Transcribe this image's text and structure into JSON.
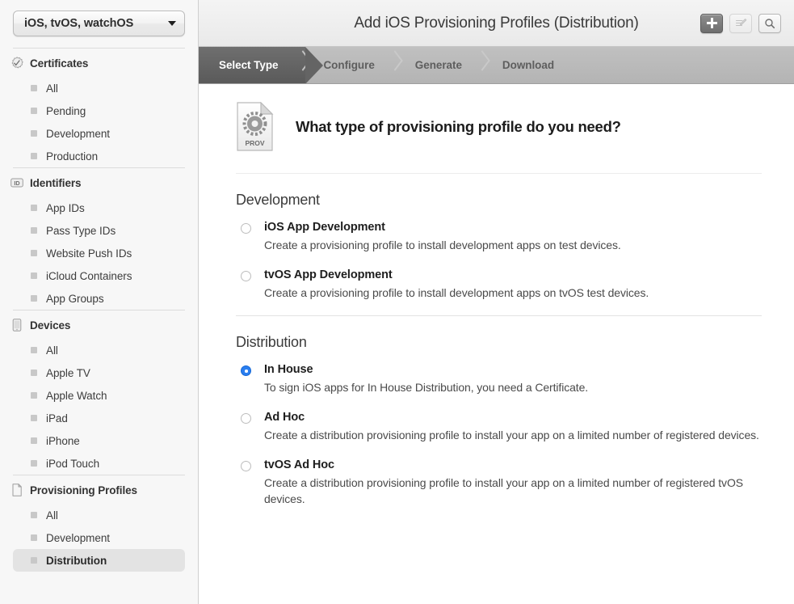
{
  "sidebar": {
    "team_select": {
      "value": "iOS, tvOS, watchOS",
      "icon": "chevron-down-icon"
    },
    "groups": [
      {
        "header": "Certificates",
        "icon": "certificate-seal-icon",
        "items": [
          {
            "label": "All",
            "selected": false
          },
          {
            "label": "Pending",
            "selected": false
          },
          {
            "label": "Development",
            "selected": false
          },
          {
            "label": "Production",
            "selected": false
          }
        ]
      },
      {
        "header": "Identifiers",
        "icon": "id-badge-icon",
        "items": [
          {
            "label": "App IDs",
            "selected": false
          },
          {
            "label": "Pass Type IDs",
            "selected": false
          },
          {
            "label": "Website Push IDs",
            "selected": false
          },
          {
            "label": "iCloud Containers",
            "selected": false
          },
          {
            "label": "App Groups",
            "selected": false
          }
        ]
      },
      {
        "header": "Devices",
        "icon": "device-icon",
        "items": [
          {
            "label": "All",
            "selected": false
          },
          {
            "label": "Apple TV",
            "selected": false
          },
          {
            "label": "Apple Watch",
            "selected": false
          },
          {
            "label": "iPad",
            "selected": false
          },
          {
            "label": "iPhone",
            "selected": false
          },
          {
            "label": "iPod Touch",
            "selected": false
          }
        ]
      },
      {
        "header": "Provisioning Profiles",
        "icon": "document-icon",
        "items": [
          {
            "label": "All",
            "selected": false
          },
          {
            "label": "Development",
            "selected": false
          },
          {
            "label": "Distribution",
            "selected": true
          }
        ]
      }
    ]
  },
  "topbar": {
    "title": "Add iOS Provisioning Profiles (Distribution)",
    "actions": [
      {
        "name": "add-button",
        "icon": "plus-icon",
        "state": "active"
      },
      {
        "name": "edit-button",
        "icon": "edit-list-icon",
        "state": "disabled"
      },
      {
        "name": "search-button",
        "icon": "search-icon",
        "state": "enabled"
      }
    ]
  },
  "steps": [
    {
      "label": "Select Type",
      "active": true
    },
    {
      "label": "Configure",
      "active": false
    },
    {
      "label": "Generate",
      "active": false
    },
    {
      "label": "Download",
      "active": false
    }
  ],
  "main": {
    "prov_icon_label": "PROV",
    "prompt": "What type of provisioning profile do you need?",
    "sections": [
      {
        "title": "Development",
        "options": [
          {
            "title": "iOS App Development",
            "desc": "Create a provisioning profile to install development apps on test devices.",
            "selected": false
          },
          {
            "title": "tvOS App Development",
            "desc": "Create a provisioning profile to install development apps on tvOS test devices.",
            "selected": false
          }
        ]
      },
      {
        "title": "Distribution",
        "options": [
          {
            "title": "In House",
            "desc": "To sign iOS apps for In House Distribution, you need a Certificate.",
            "selected": true
          },
          {
            "title": "Ad Hoc",
            "desc": "Create a distribution provisioning profile to install your app on a limited number of registered devices.",
            "selected": false
          },
          {
            "title": "tvOS Ad Hoc",
            "desc": "Create a distribution provisioning profile to install your app on a limited number of registered tvOS devices.",
            "selected": false
          }
        ]
      }
    ]
  },
  "colors": {
    "accent_blue": "#2a7ef0",
    "sidebar_bg": "#f7f7f7",
    "step_active_bg": "#646464",
    "steps_bar_bg": "#b8b8b8"
  }
}
